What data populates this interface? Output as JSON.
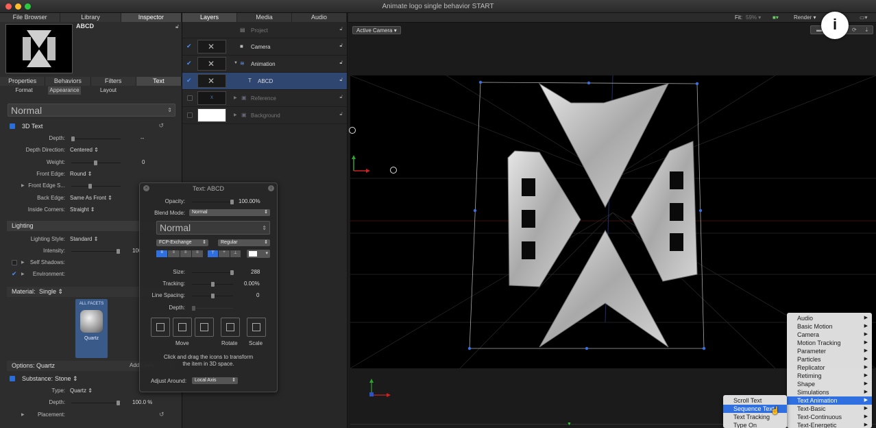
{
  "window": {
    "title": "Animate logo single behavior START"
  },
  "left_tabs": [
    "File Browser",
    "Library",
    "Inspector"
  ],
  "preview": {
    "name": "ABCD"
  },
  "inspector_tabs": [
    "Properties",
    "Behaviors",
    "Filters",
    "Text"
  ],
  "text_subtabs": [
    "Format",
    "Appearance",
    "Layout"
  ],
  "style_preset": "Normal",
  "text3d": {
    "header": "3D Text",
    "depth_label": "Depth:",
    "depth_value": "--",
    "direction_label": "Depth Direction:",
    "direction_value": "Centered",
    "weight_label": "Weight:",
    "weight_value": "0",
    "front_edge_label": "Front Edge:",
    "front_edge_value": "Round",
    "front_edge_size_label": "Front Edge S...",
    "back_edge_label": "Back Edge:",
    "back_edge_value": "Same As Front",
    "inside_label": "Inside Corners:",
    "inside_value": "Straight"
  },
  "lighting": {
    "header": "Lighting",
    "style_label": "Lighting Style:",
    "style_value": "Standard",
    "intensity_label": "Intensity:",
    "intensity_value": "100",
    "shadows_label": "Self Shadows:",
    "environment_label": "Environment:"
  },
  "material": {
    "label": "Material:",
    "value": "Single",
    "facets": "ALL FACETS",
    "swatch": "Quartz"
  },
  "options": {
    "label": "Options: Quartz",
    "add_label": "Add Layer"
  },
  "substance": {
    "label": "Substance:",
    "value": "Stone",
    "type_label": "Type:",
    "type_value": "Quartz",
    "depth_label": "Depth:",
    "depth_value": "100.0 %",
    "placement_label": "Placement:"
  },
  "layers_tabs": [
    "Layers",
    "Media",
    "Audio"
  ],
  "layers": [
    {
      "name": "Project"
    },
    {
      "name": "Camera"
    },
    {
      "name": "Animation"
    },
    {
      "name": "ABCD"
    },
    {
      "name": "Reference"
    },
    {
      "name": "Background"
    }
  ],
  "toolbar": {
    "fit_label": "Fit:",
    "fit_value": "59%",
    "render_label": "Render",
    "camera": "Active Camera"
  },
  "hud": {
    "title": "Text: ABCD",
    "opacity_label": "Opacity:",
    "opacity_value": "100.00%",
    "blend_label": "Blend Mode:",
    "blend_value": "Normal",
    "preset": "Normal",
    "font": "FCP-Exchange",
    "weight": "Regular",
    "size_label": "Size:",
    "size_value": "288",
    "tracking_label": "Tracking:",
    "tracking_value": "0.00%",
    "spacing_label": "Line Spacing:",
    "spacing_value": "0",
    "depth_label": "Depth:",
    "move": "Move",
    "rotate": "Rotate",
    "scale": "Scale",
    "hint1": "Click and drag the icons to transform",
    "hint2": "the item in 3D space.",
    "adjust_label": "Adjust Around:",
    "adjust_value": "Local Axis"
  },
  "behavior_menu": [
    "Audio",
    "Basic Motion",
    "Camera",
    "Motion Tracking",
    "Parameter",
    "Particles",
    "Replicator",
    "Retiming",
    "Shape",
    "Simulations",
    "Text Animation",
    "Text-Basic",
    "Text-Continuous",
    "Text-Energetic"
  ],
  "text_anim_menu": [
    "Scroll Text",
    "Sequence Text",
    "Text Tracking",
    "Type On"
  ],
  "colors": {
    "accent": "#2f6fe0",
    "selection": "#2e4670"
  }
}
